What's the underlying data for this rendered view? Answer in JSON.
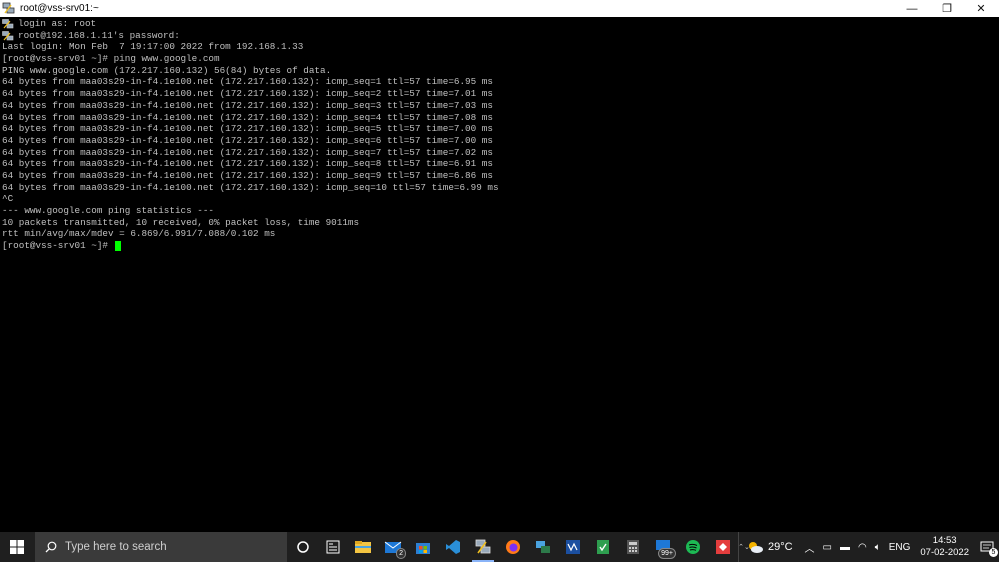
{
  "window": {
    "title": "root@vss-srv01:~",
    "controls": {
      "minimize": "—",
      "restore": "❐",
      "close": "✕"
    }
  },
  "terminal": {
    "lines": [
      {
        "icon": true,
        "text": "login as: root"
      },
      {
        "icon": true,
        "text": "root@192.168.1.11's password:"
      },
      {
        "icon": false,
        "text": "Last login: Mon Feb  7 19:17:00 2022 from 192.168.1.33"
      },
      {
        "icon": false,
        "text": "[root@vss-srv01 ~]# ping www.google.com"
      },
      {
        "icon": false,
        "text": "PING www.google.com (172.217.160.132) 56(84) bytes of data."
      },
      {
        "icon": false,
        "text": "64 bytes from maa03s29-in-f4.1e100.net (172.217.160.132): icmp_seq=1 ttl=57 time=6.95 ms"
      },
      {
        "icon": false,
        "text": "64 bytes from maa03s29-in-f4.1e100.net (172.217.160.132): icmp_seq=2 ttl=57 time=7.01 ms"
      },
      {
        "icon": false,
        "text": "64 bytes from maa03s29-in-f4.1e100.net (172.217.160.132): icmp_seq=3 ttl=57 time=7.03 ms"
      },
      {
        "icon": false,
        "text": "64 bytes from maa03s29-in-f4.1e100.net (172.217.160.132): icmp_seq=4 ttl=57 time=7.08 ms"
      },
      {
        "icon": false,
        "text": "64 bytes from maa03s29-in-f4.1e100.net (172.217.160.132): icmp_seq=5 ttl=57 time=7.00 ms"
      },
      {
        "icon": false,
        "text": "64 bytes from maa03s29-in-f4.1e100.net (172.217.160.132): icmp_seq=6 ttl=57 time=7.00 ms"
      },
      {
        "icon": false,
        "text": "64 bytes from maa03s29-in-f4.1e100.net (172.217.160.132): icmp_seq=7 ttl=57 time=7.02 ms"
      },
      {
        "icon": false,
        "text": "64 bytes from maa03s29-in-f4.1e100.net (172.217.160.132): icmp_seq=8 ttl=57 time=6.91 ms"
      },
      {
        "icon": false,
        "text": "64 bytes from maa03s29-in-f4.1e100.net (172.217.160.132): icmp_seq=9 ttl=57 time=6.86 ms"
      },
      {
        "icon": false,
        "text": "64 bytes from maa03s29-in-f4.1e100.net (172.217.160.132): icmp_seq=10 ttl=57 time=6.99 ms"
      },
      {
        "icon": false,
        "text": "^C"
      },
      {
        "icon": false,
        "text": "--- www.google.com ping statistics ---"
      },
      {
        "icon": false,
        "text": "10 packets transmitted, 10 received, 0% packet loss, time 9011ms"
      },
      {
        "icon": false,
        "text": "rtt min/avg/max/mdev = 6.869/6.991/7.088/0.102 ms"
      },
      {
        "icon": false,
        "text": "[root@vss-srv01 ~]# ",
        "cursor": true
      }
    ],
    "text_color": "#c0c0c0",
    "cursor_color": "#00ff00"
  },
  "taskbar": {
    "search_placeholder": "Type here to search",
    "pinned": [
      {
        "name": "task-view-icon"
      },
      {
        "name": "widgets-icon"
      },
      {
        "name": "file-explorer-icon"
      },
      {
        "name": "mail-icon",
        "badge": "2"
      },
      {
        "name": "store-icon"
      },
      {
        "name": "vscode-icon"
      },
      {
        "name": "putty-icon",
        "active": true
      },
      {
        "name": "firefox-icon"
      },
      {
        "name": "network-app-icon"
      },
      {
        "name": "vm-app-icon"
      },
      {
        "name": "notepad-app-icon"
      },
      {
        "name": "calculator-icon"
      },
      {
        "name": "notification-app-icon",
        "badge": "99+"
      },
      {
        "name": "spotify-icon"
      },
      {
        "name": "anydesk-icon"
      }
    ],
    "tray": {
      "temperature": "29°C",
      "language": "ENG",
      "time": "14:53",
      "date": "07-02-2022",
      "notifications": "5"
    }
  }
}
